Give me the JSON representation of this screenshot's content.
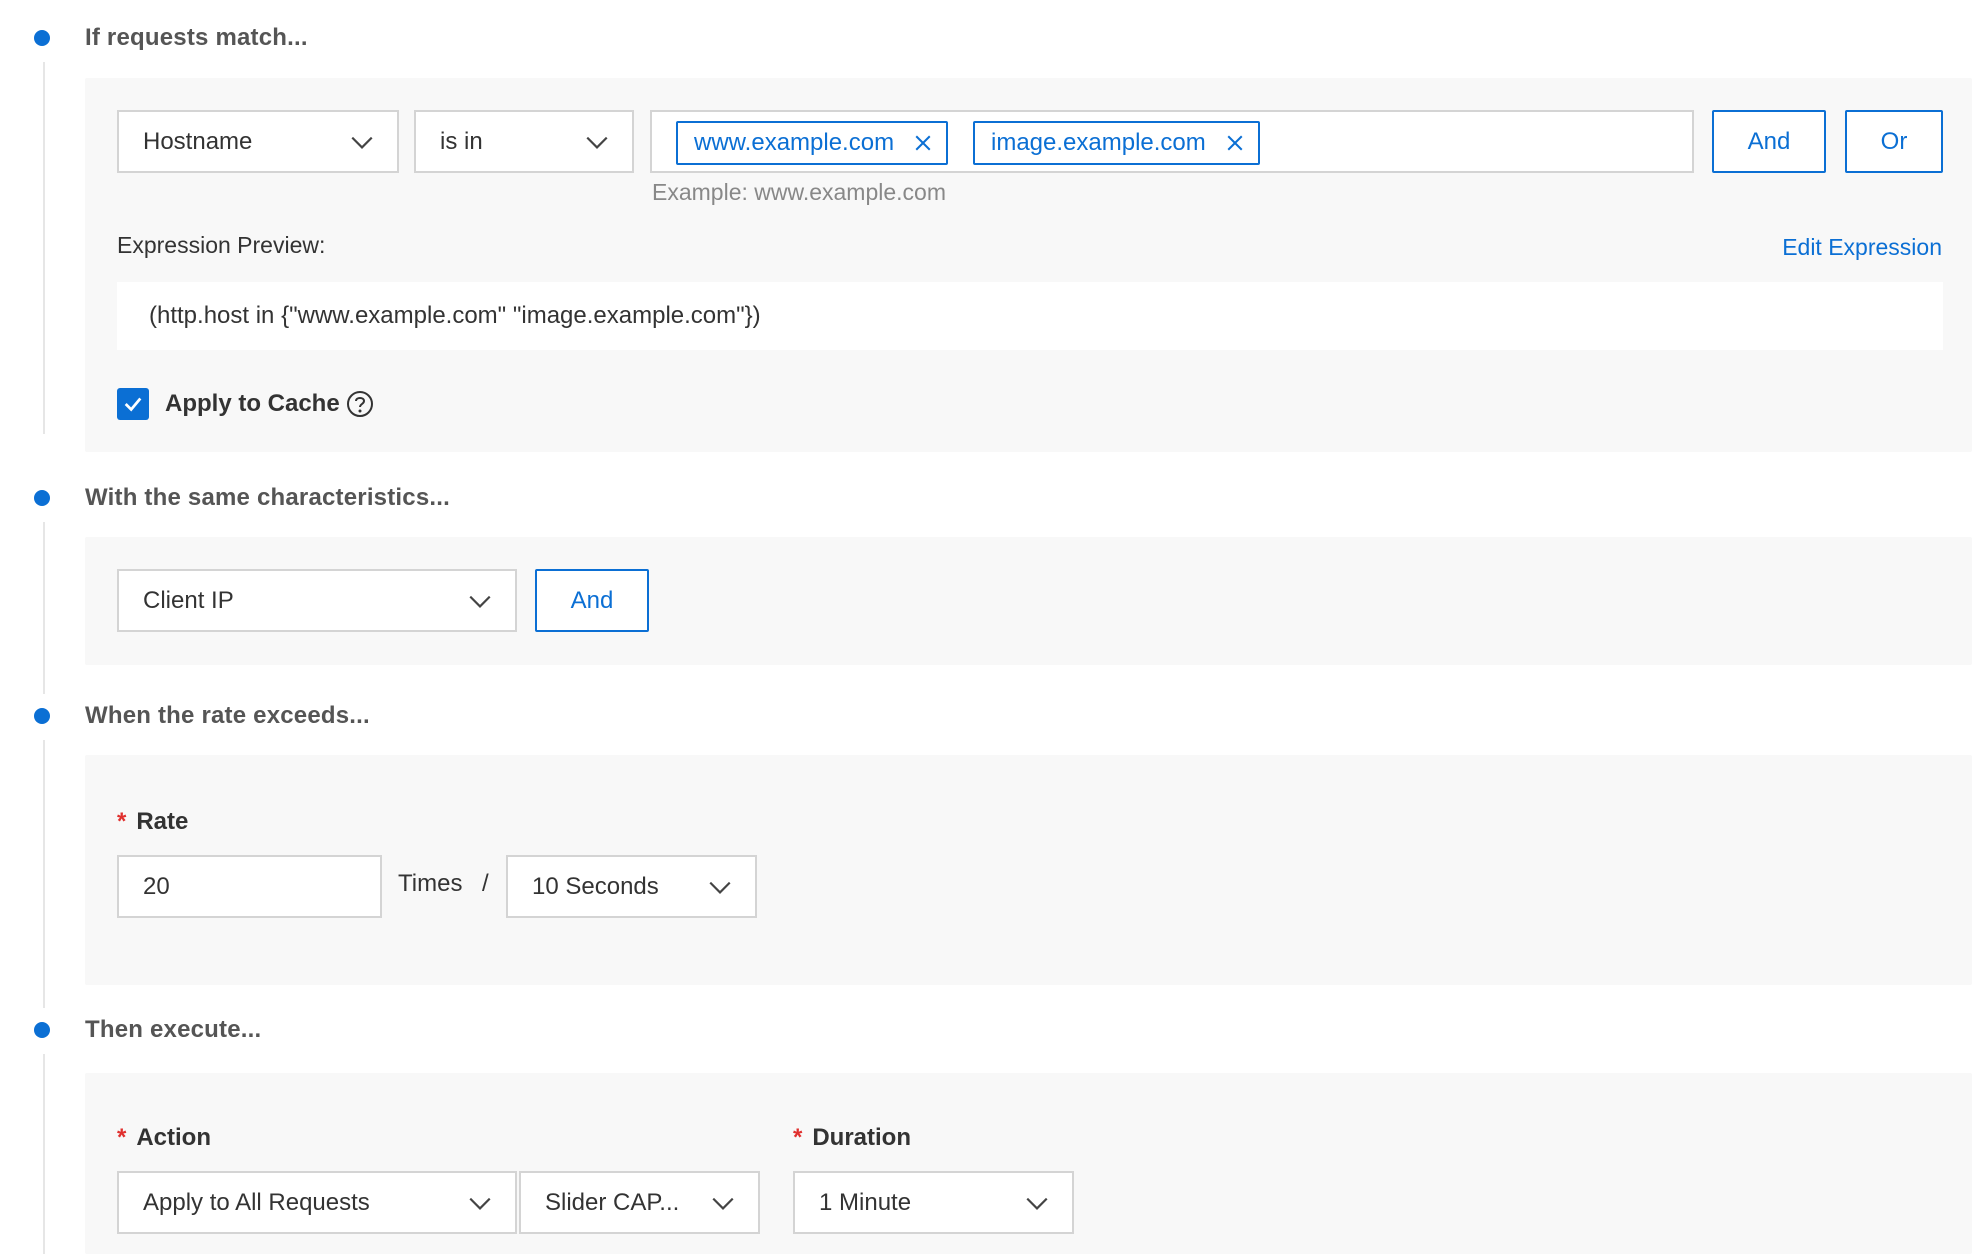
{
  "steps": {
    "match": {
      "title": "If requests match...",
      "field_select": "Hostname",
      "operator_select": "is in",
      "tags": [
        {
          "label": "www.example.com"
        },
        {
          "label": "image.example.com"
        }
      ],
      "and_label": "And",
      "or_label": "Or",
      "hint": "Example: www.example.com",
      "preview_label": "Expression Preview:",
      "edit_expression_label": "Edit Expression",
      "expression": "(http.host in {\"www.example.com\" \"image.example.com\"})",
      "apply_to_cache_label": "Apply to Cache",
      "apply_to_cache_checked": true
    },
    "characteristics": {
      "title": "With the same characteristics...",
      "select": "Client IP",
      "and_label": "And"
    },
    "rate": {
      "title": "When the rate exceeds...",
      "rate_label": "Rate",
      "required_mark": "*",
      "rate_value": "20",
      "times_label": "Times",
      "separator": "/",
      "period_select": "10 Seconds"
    },
    "execute": {
      "title": "Then execute...",
      "required_mark": "*",
      "action_label": "Action",
      "action_select": "Apply to All Requests",
      "challenge_select": "Slider CAP...",
      "duration_label": "Duration",
      "duration_select": "1 Minute"
    }
  },
  "colors": {
    "accent": "#0b6fd4",
    "required": "#e0302e",
    "panel_bg": "#f8f8f8"
  }
}
